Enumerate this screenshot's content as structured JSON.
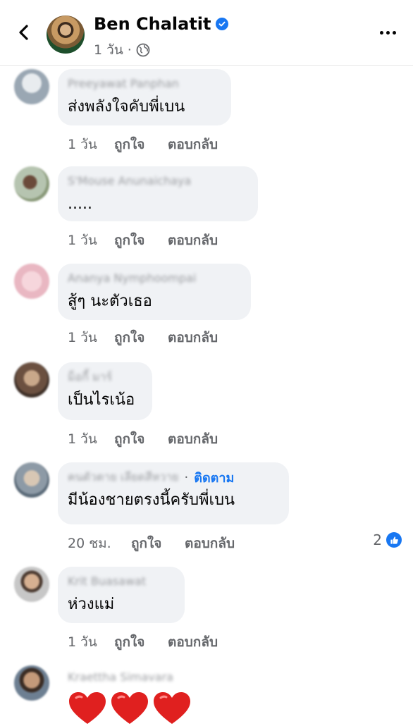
{
  "header": {
    "page_name": "Ben Chalatit",
    "time": "1 วัน",
    "separator": "·"
  },
  "colors": {
    "accent": "#1877f2",
    "bubble": "#f0f2f5",
    "secondary_text": "#65676b"
  },
  "actions": {
    "like": "ถูกใจ",
    "reply": "ตอบกลับ"
  },
  "comments": [
    {
      "author": "Preeyawat Panphan",
      "text": "ส่งพลังใจคับพี่เบน",
      "time": "1 วัน"
    },
    {
      "author": "S'Mouse Anunaichaya",
      "text": ".....",
      "time": "1 วัน"
    },
    {
      "author": "Ananya Nymphoompai",
      "text": "สู้ๆ นะตัวเธอ",
      "time": "1 วัน"
    },
    {
      "author": "ม็อกี้ มาร์",
      "text": "เป็นไรเน้อ",
      "time": "1 วัน"
    },
    {
      "author": "คนตัวตาย เลียดสีหวาย",
      "follow": "ติดตาม",
      "separator": "·",
      "text": "มีน้องชายตรงนี้ครับพี่เบน",
      "time": "20 ชม.",
      "reaction_count": "2"
    },
    {
      "author": "Krit Buasawat",
      "text": "ห่วงแม่",
      "time": "1 วัน"
    },
    {
      "author": "Kraettha Simavara",
      "text": "❤❤❤",
      "time": ""
    }
  ]
}
